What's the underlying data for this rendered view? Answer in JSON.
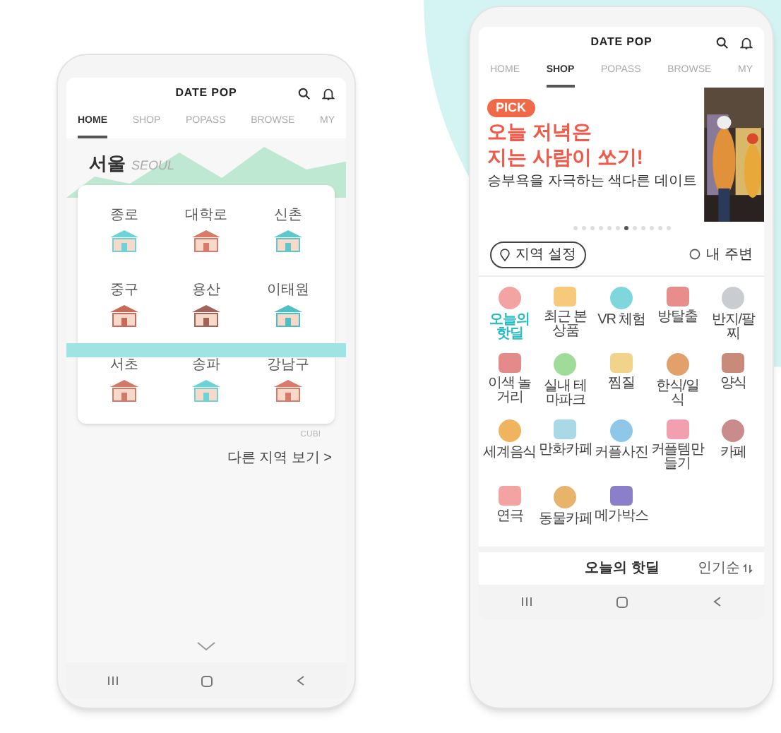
{
  "left_phone": {
    "app_title": "DATE POP",
    "tabs": [
      {
        "label": "HOME",
        "selected": true
      },
      {
        "label": "SHOP",
        "selected": false
      },
      {
        "label": "POPASS",
        "selected": false
      },
      {
        "label": "BROWSE",
        "selected": false
      },
      {
        "label": "MY",
        "selected": false
      }
    ],
    "city": {
      "name": "서울",
      "subtitle": "SEOUL"
    },
    "districts": [
      {
        "label": "종로"
      },
      {
        "label": "대학로"
      },
      {
        "label": "신촌"
      },
      {
        "label": "중구"
      },
      {
        "label": "용산"
      },
      {
        "label": "이태원"
      },
      {
        "label": "서초"
      },
      {
        "label": "송파"
      },
      {
        "label": "강남구"
      }
    ],
    "side_label": "CUBI",
    "more_link": "다른 지역 보기 >"
  },
  "right_phone": {
    "app_title": "DATE POP",
    "tabs": [
      {
        "label": "HOME",
        "selected": false
      },
      {
        "label": "SHOP",
        "selected": true
      },
      {
        "label": "POPASS",
        "selected": false
      },
      {
        "label": "BROWSE",
        "selected": false
      },
      {
        "label": "MY",
        "selected": false
      }
    ],
    "banner": {
      "badge": "PICK",
      "title_lines": [
        "오늘 저녁은",
        "지는 사람이 쏘기!"
      ],
      "subtitle": "승부욕을 자극하는 색다른 데이트"
    },
    "pager": [
      {
        "selected": false
      },
      {
        "selected": false
      },
      {
        "selected": false
      },
      {
        "selected": false
      },
      {
        "selected": false
      },
      {
        "selected": false
      },
      {
        "selected": true
      },
      {
        "selected": false
      },
      {
        "selected": false
      },
      {
        "selected": false
      },
      {
        "selected": false
      },
      {
        "selected": false
      }
    ],
    "location_button": "지역 설정",
    "nearby": "내 주변",
    "categories": [
      {
        "label": "오늘의 핫딜",
        "selected": true
      },
      {
        "label": "최근 본 상품",
        "selected": false
      },
      {
        "label": "VR 체험",
        "selected": false
      },
      {
        "label": "방탈출",
        "selected": false
      },
      {
        "label": "반지/팔찌",
        "selected": false
      },
      {
        "label": "이색 놀거리",
        "selected": false
      },
      {
        "label": "실내 테마파크",
        "selected": false
      },
      {
        "label": "찜질",
        "selected": false
      },
      {
        "label": "한식/일식",
        "selected": false
      },
      {
        "label": "양식",
        "selected": false
      },
      {
        "label": "세계음식",
        "selected": false
      },
      {
        "label": "만화카페",
        "selected": false
      },
      {
        "label": "커플사진",
        "selected": false
      },
      {
        "label": "커플템만들기",
        "selected": false
      },
      {
        "label": "카페",
        "selected": false
      },
      {
        "label": "연극",
        "selected": false
      },
      {
        "label": "동물카페",
        "selected": false
      },
      {
        "label": "메가박스",
        "selected": false
      }
    ],
    "section_title": "오늘의 핫딜",
    "sort": "인기순"
  }
}
